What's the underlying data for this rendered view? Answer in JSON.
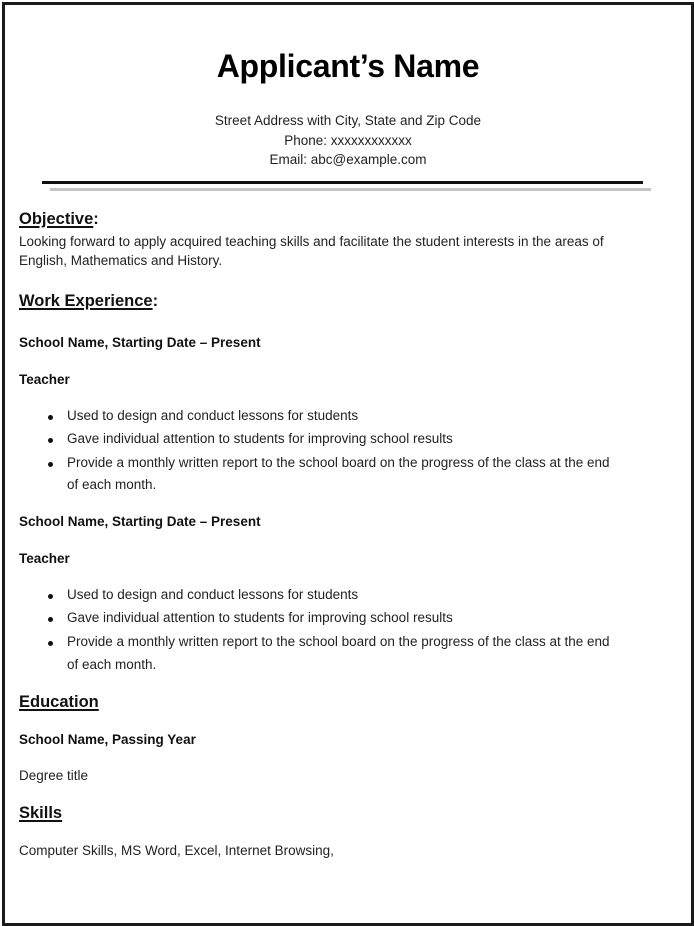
{
  "header": {
    "name": "Applicant’s Name",
    "address": "Street Address with City, State and Zip Code",
    "phone": "Phone: xxxxxxxxxxxx",
    "email": "Email: abc@example.com"
  },
  "objective": {
    "title": "Objective",
    "colon": ":",
    "line1": "Looking forward to apply acquired teaching skills and facilitate the student  interests in the areas of",
    "line2": "English, Mathematics and History."
  },
  "work_experience": {
    "title": "Work Experience",
    "colon": ":",
    "jobs": [
      {
        "employer": "School Name, Starting Date – Present",
        "role": "Teacher",
        "bullets": [
          "Used to design and conduct lessons for students",
          "Gave individual attention  to students  for improving school  results",
          "Provide a monthly written report to the school board on the progress of the class at the end"
        ],
        "bullet_continuation": "of each month."
      },
      {
        "employer": "School Name, Starting Date – Present",
        "role": "Teacher",
        "bullets": [
          "Used to design and conduct lessons for students",
          "Gave individual attention  to students  for improving school  results",
          "Provide a monthly written report to the school board on the progress of the class at the end"
        ],
        "bullet_continuation": "of each month."
      }
    ]
  },
  "education": {
    "title": "Education",
    "school": "School Name, Passing Year",
    "degree": "Degree title"
  },
  "skills": {
    "title": "Skills",
    "list": "Computer Skills, MS Word,  Excel, Internet Browsing,"
  }
}
